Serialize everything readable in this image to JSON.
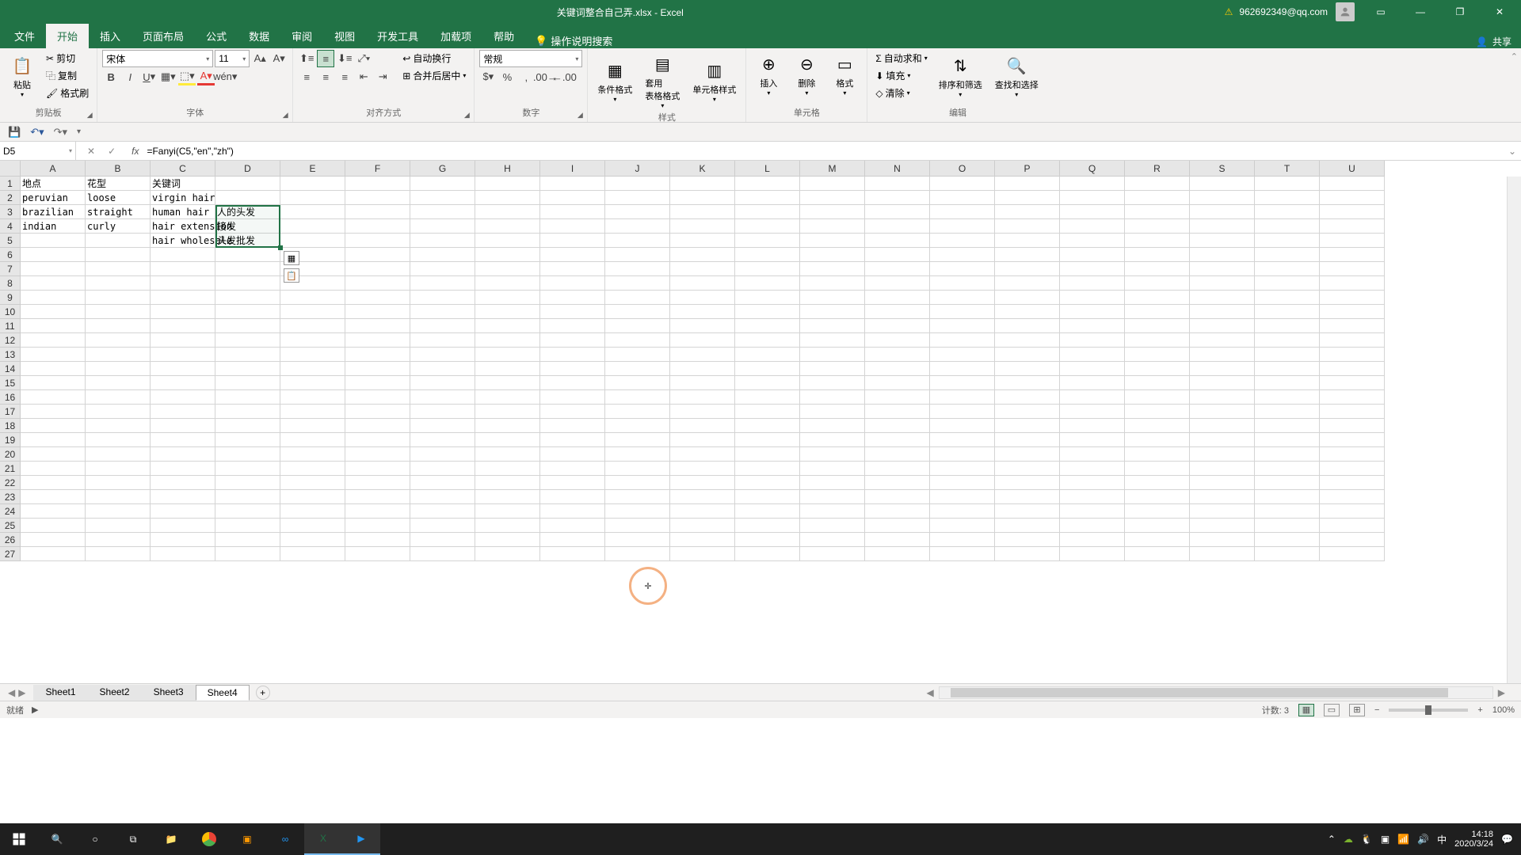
{
  "titlebar": {
    "doc_title": "关键词整合自己弄.xlsx - Excel",
    "user": "962692349@qq.com"
  },
  "tabs": {
    "file": "文件",
    "home": "开始",
    "insert": "插入",
    "layout": "页面布局",
    "formulas": "公式",
    "data": "数据",
    "review": "审阅",
    "view": "视图",
    "developer": "开发工具",
    "addins": "加载项",
    "help": "帮助",
    "tellme": "操作说明搜索",
    "share": "共享"
  },
  "ribbon": {
    "clipboard": {
      "paste": "粘贴",
      "cut": "剪切",
      "copy": "复制",
      "painter": "格式刷",
      "label": "剪贴板"
    },
    "font": {
      "name": "宋体",
      "size": "11",
      "label": "字体"
    },
    "align": {
      "wrap": "自动换行",
      "merge": "合并后居中",
      "label": "对齐方式"
    },
    "number": {
      "format": "常规",
      "label": "数字"
    },
    "styles": {
      "cond": "条件格式",
      "table": "套用\n表格格式",
      "cell": "单元格样式",
      "label": "样式"
    },
    "cells": {
      "insert": "插入",
      "delete": "删除",
      "format": "格式",
      "label": "单元格"
    },
    "editing": {
      "sum": "自动求和",
      "fill": "填充",
      "clear": "清除",
      "sort": "排序和筛选",
      "find": "查找和选择",
      "label": "编辑"
    }
  },
  "fbar": {
    "namebox": "D5",
    "formula": "=Fanyi(C5,\"en\",\"zh\")"
  },
  "columns": [
    "A",
    "B",
    "C",
    "D",
    "E",
    "F",
    "G",
    "H",
    "I",
    "J",
    "K",
    "L",
    "M",
    "N",
    "O",
    "P",
    "Q",
    "R",
    "S",
    "T",
    "U"
  ],
  "grid": {
    "r1": {
      "A": "地点",
      "B": "花型",
      "C": "关键词"
    },
    "r2": {
      "A": "peruvian",
      "B": "loose",
      "C": "virgin hair"
    },
    "r3": {
      "A": "brazilian",
      "B": "straight",
      "C": "human hair",
      "D": "人的头发"
    },
    "r4": {
      "A": "indian",
      "B": "curly",
      "C": "hair extension",
      "D": "接发"
    },
    "r5": {
      "C": "hair wholesale",
      "D": "头发批发"
    }
  },
  "sheet_tabs": [
    "Sheet1",
    "Sheet2",
    "Sheet3",
    "Sheet4"
  ],
  "active_sheet": 3,
  "status": {
    "ready": "就绪",
    "count_label": "计数:",
    "count": "3",
    "zoom": "100%"
  },
  "taskbar": {
    "time": "14:18",
    "date": "2020/3/24",
    "ime": "中"
  },
  "chart_data": null
}
